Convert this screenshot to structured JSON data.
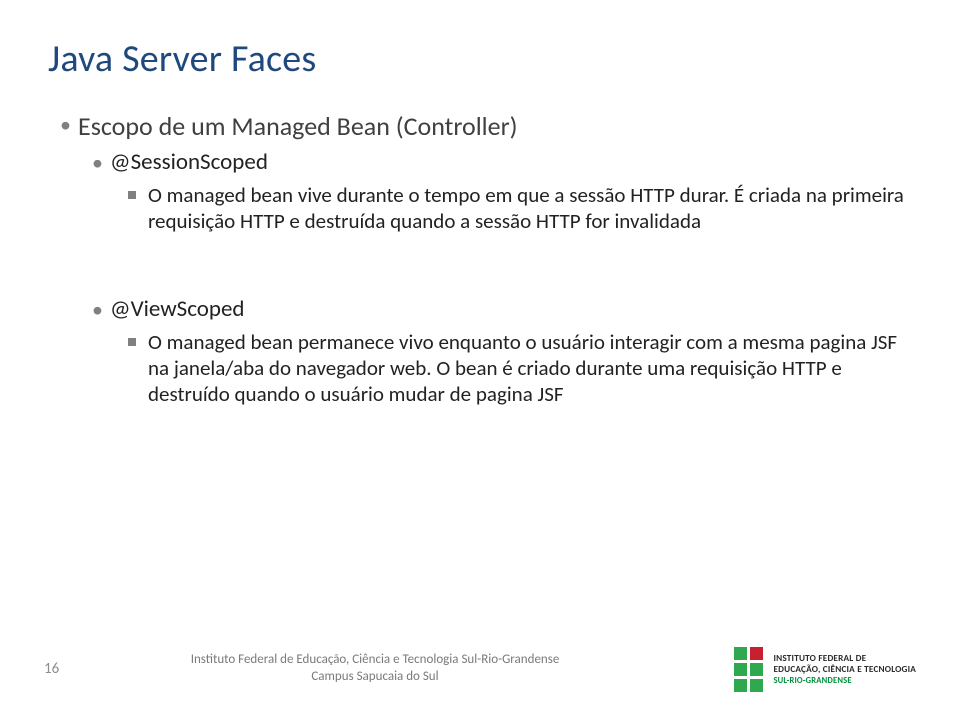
{
  "title": "Java Server Faces",
  "l1": "Escopo de um Managed Bean (Controller)",
  "s1": {
    "heading": "@SessionScoped",
    "body": "O managed bean vive durante o tempo em que a sessão HTTP durar. É criada na primeira requisição HTTP e destruída quando a sessão HTTP for invalidada"
  },
  "s2": {
    "heading": "@ViewScoped",
    "body": "O managed bean permanece vivo enquanto o usuário interagir com a mesma pagina JSF na janela/aba do navegador web. O bean é criado durante uma requisição HTTP e destruído quando o usuário mudar de pagina JSF"
  },
  "footer": {
    "page": "16",
    "inst_line1": "Instituto Federal de Educação, Ciência e Tecnologia Sul-Rio-Grandense",
    "inst_line2": "Campus Sapucaia do Sul",
    "logo_line1": "INSTITUTO FEDERAL DE",
    "logo_line2": "EDUCAÇÃO, CIÊNCIA E TECNOLOGIA",
    "logo_line3": "SUL-RIO-GRANDENSE"
  },
  "logo_colors": {
    "green": "#2fa84f",
    "red": "#c8202f"
  }
}
